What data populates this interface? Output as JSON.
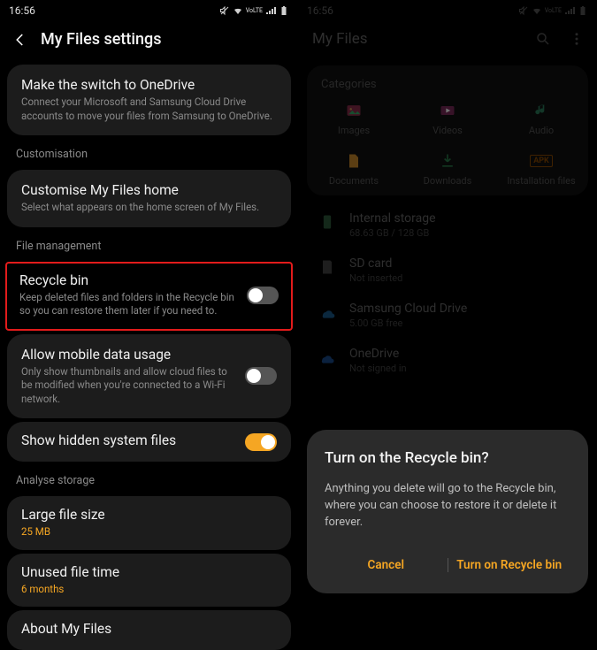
{
  "left": {
    "status_time": "16:56",
    "header": "My Files settings",
    "onedrive": {
      "title": "Make the switch to OneDrive",
      "sub": "Connect your Microsoft and Samsung Cloud Drive accounts to move your files from Samsung to OneDrive."
    },
    "section_custom": "Customisation",
    "custom_home": {
      "title": "Customise My Files home",
      "sub": "Select what appears on the home screen of My Files."
    },
    "section_filemgmt": "File management",
    "recycle": {
      "title": "Recycle bin",
      "sub": "Keep deleted files and folders in the Recycle bin so you can restore them later if you need to."
    },
    "mobiledata": {
      "title": "Allow mobile data usage",
      "sub": "Only show thumbnails and allow cloud files to be modified when you're connected to a Wi-Fi network."
    },
    "hidden": {
      "title": "Show hidden system files"
    },
    "section_analyse": "Analyse storage",
    "largefile": {
      "title": "Large file size",
      "value": "25 MB"
    },
    "unused": {
      "title": "Unused file time",
      "value": "6 months"
    },
    "about": {
      "title": "About My Files"
    }
  },
  "right": {
    "status_time": "16:56",
    "header": "My Files",
    "categories_label": "Categories",
    "cats": {
      "images": "Images",
      "videos": "Videos",
      "audio": "Audio",
      "documents": "Documents",
      "downloads": "Downloads",
      "apk": "Installation files",
      "apk_badge": "APK"
    },
    "storage": {
      "internal": {
        "t": "Internal storage",
        "s": "68.63 GB / 128 GB"
      },
      "sd": {
        "t": "SD card",
        "s": "Not inserted"
      },
      "samsung": {
        "t": "Samsung Cloud Drive",
        "s": "5.00 GB free"
      },
      "onedrive": {
        "t": "OneDrive",
        "s": "Not signed in"
      }
    },
    "dialog": {
      "title": "Turn on the Recycle bin?",
      "body": "Anything you delete will go to the Recycle bin, where you can choose to restore it or delete it forever.",
      "cancel": "Cancel",
      "confirm": "Turn on Recycle bin"
    }
  }
}
